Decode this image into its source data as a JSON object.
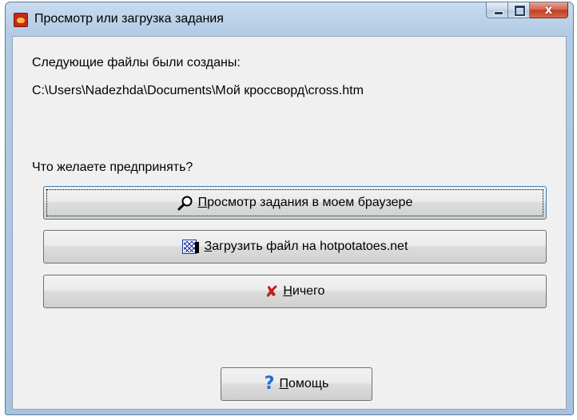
{
  "window": {
    "title": "Просмотр или загрузка задания",
    "controls": {
      "close_glyph": "x"
    }
  },
  "message": {
    "line1": "Следующие файлы были созданы:",
    "path": "C:\\Users\\Nadezhda\\Documents\\Мой кроссворд\\cross.htm",
    "question": "Что желаете предпринять?"
  },
  "buttons": {
    "view": {
      "mnemonic": "П",
      "rest": "росмотр задания в моем браузере",
      "icon": "magnifier-icon"
    },
    "upload": {
      "mnemonic": "З",
      "rest": "агрузить файл на hotpotatoes.net",
      "icon": "web-icon"
    },
    "nothing": {
      "mnemonic": "Н",
      "rest": "ичего",
      "icon": "red-x-icon"
    },
    "help": {
      "mnemonic": "П",
      "rest": "омощь",
      "icon": "question-icon"
    }
  },
  "icons": {
    "x_glyph": "✘",
    "q_glyph": "?"
  },
  "colors": {
    "close_red": "#c23b22",
    "x_red": "#c21f13",
    "help_blue": "#1a6fd1"
  }
}
